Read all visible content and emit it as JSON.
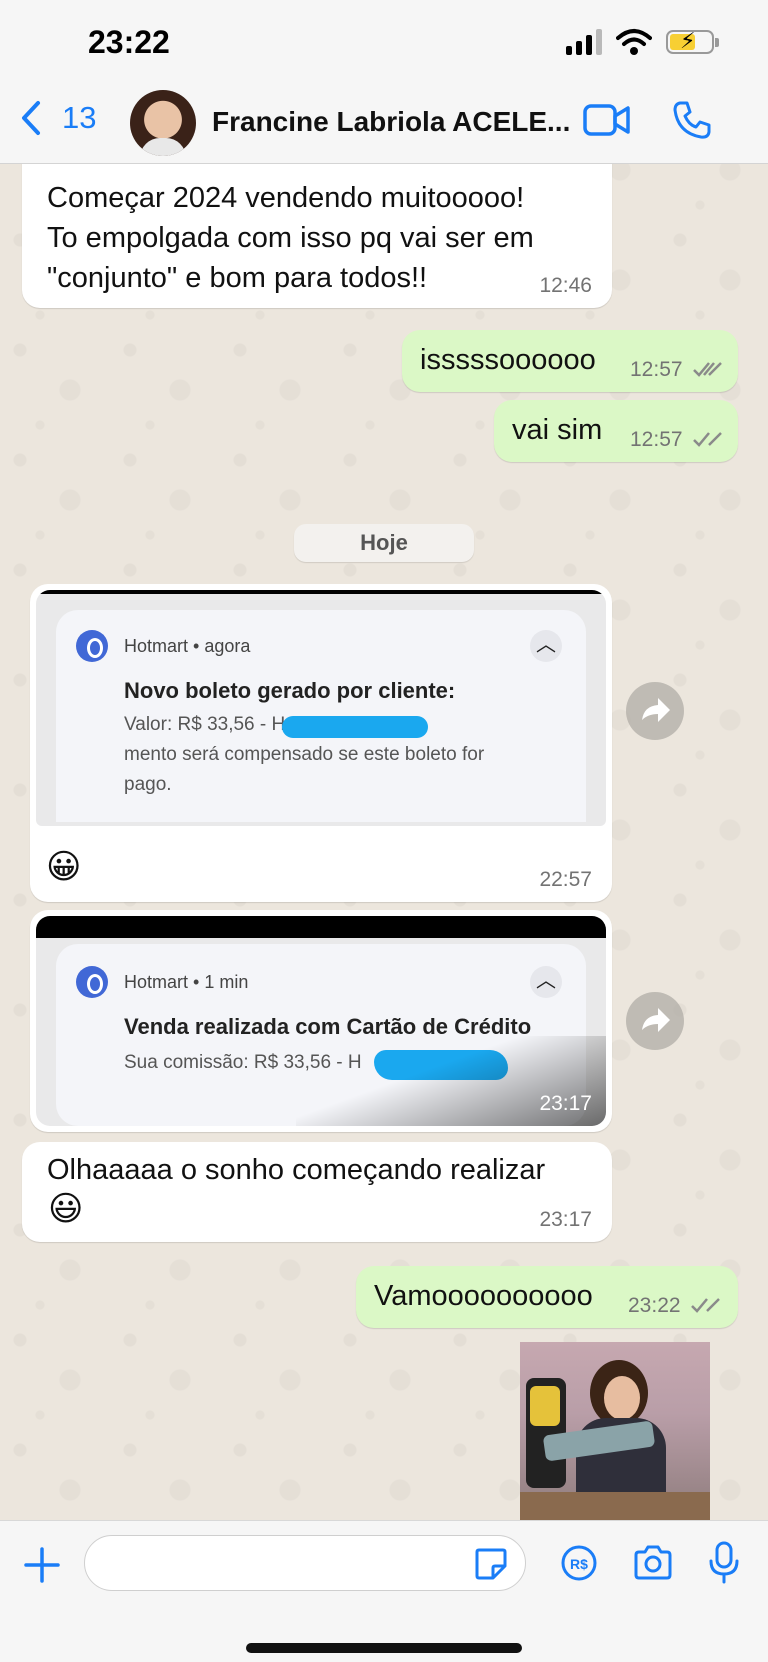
{
  "status_bar": {
    "time": "23:22"
  },
  "header": {
    "back_count": "13",
    "contact_name": "Francine Labriola ACELE...",
    "icons": [
      "chevron-left-icon",
      "video-call-icon",
      "phone-icon"
    ]
  },
  "messages": {
    "m1": {
      "text": "Começar 2024 vendendo muitooooo!\nTo empolgada com isso pq vai ser em\n\"conjunto\" e bom para todos!!",
      "time": "12:46"
    },
    "m2": {
      "text": "isssssoooooo",
      "time": "12:57"
    },
    "m3": {
      "text": "vai sim",
      "time": "12:57"
    },
    "day_separator": "Hoje",
    "m4": {
      "app_line": "Hotmart • agora",
      "title": "Novo boleto gerado por cliente:",
      "body": "Valor: R$ 33,56 - H                    O paga-\nmento será compensado se este boleto for\npago.",
      "emoji": "😀",
      "time": "22:57"
    },
    "m5": {
      "app_line": "Hotmart • 1 min",
      "title": "Venda realizada com Cartão de Crédito",
      "body": "Sua comissão: R$ 33,56 - H",
      "time": "23:17"
    },
    "m6": {
      "text": "Olhaaaaa o sonho começando realizar",
      "emoji": "😃",
      "time": "23:17"
    },
    "m7": {
      "text": "Vamoooooooooo",
      "time": "23:22"
    }
  },
  "colors": {
    "incoming": "#ffffff",
    "outgoing": "#dbf8c6",
    "accent": "#1a7df7",
    "wallpaper": "#efeae2"
  }
}
